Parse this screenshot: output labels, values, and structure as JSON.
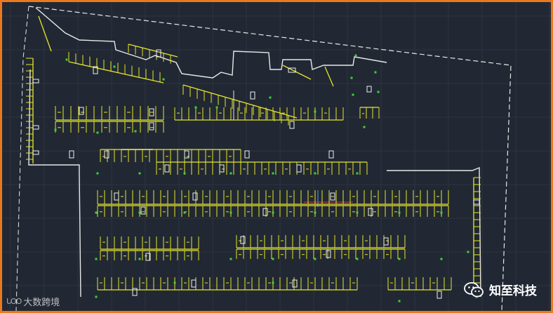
{
  "frame": {
    "border_color": "#e8791e",
    "background_color": "#212833"
  },
  "drawing": {
    "type": "cad-floor-plan",
    "subject": "underground-parking-layout",
    "colors": {
      "grid": "#2d3542",
      "boundary": "#e8e8e8",
      "parking_lines": "#e6e62a",
      "green_markers": "#39d43a",
      "cars": "#f0f0f0",
      "red_line": "#e03a3a"
    }
  },
  "watermarks": {
    "left": {
      "logo": "ᒐOO",
      "text": "大数跨境"
    },
    "right": {
      "icon": "wechat-icon",
      "text": "知至科技"
    }
  }
}
